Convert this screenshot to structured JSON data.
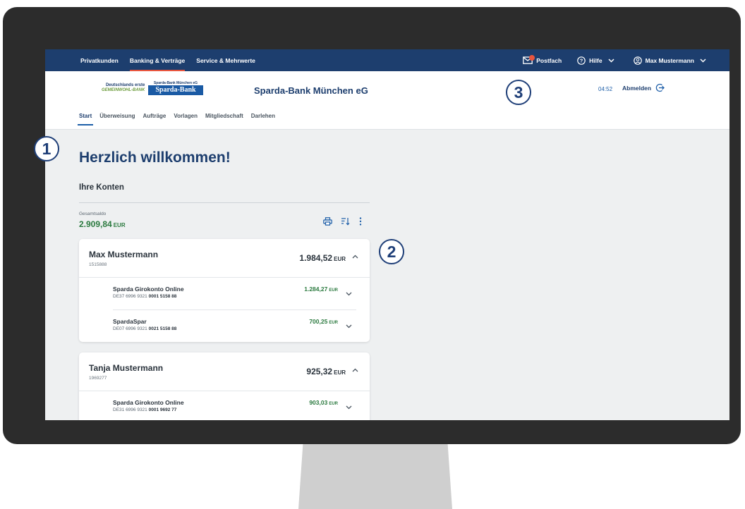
{
  "topnav": {
    "items": [
      {
        "label": "Privatkunden",
        "active": false
      },
      {
        "label": "Banking & Verträge",
        "active": true
      },
      {
        "label": "Service & Mehrwerte",
        "active": false
      }
    ],
    "postfach": "Postfach",
    "hilfe": "Hilfe",
    "user": "Max Mustermann"
  },
  "header": {
    "logo": {
      "tagline1": "Deutschlands erste",
      "tagline2": "GEMEINWOHL-BANK",
      "small": "Sparda-Bank München eG",
      "box": "Sparda-Bank"
    },
    "bank_name": "Sparda-Bank München eG",
    "timer": "04:52",
    "logout": "Abmelden",
    "tabs": [
      "Start",
      "Überweisung",
      "Aufträge",
      "Vorlagen",
      "Mitgliedschaft",
      "Darlehen"
    ]
  },
  "main": {
    "welcome": "Herzlich willkommen!",
    "konten_title": "Ihre Konten",
    "gesamtsaldo_label": "Gesamtsaldo",
    "gesamtsaldo_value": "2.909,84",
    "currency": "EUR",
    "cards": [
      {
        "owner": "Max Mustermann",
        "customer_no": "1515888",
        "total": "1.984,52",
        "accounts": [
          {
            "name": "Sparda Girokonto Online",
            "iban_prefix": "DE37 6996 9321",
            "iban_suffix": "0001 5158 88",
            "balance": "1.284,27"
          },
          {
            "name": "SpardaSpar",
            "iban_prefix": "DE07 6996 9321",
            "iban_suffix": "0021 5158 88",
            "balance": "700,25"
          }
        ]
      },
      {
        "owner": "Tanja Mustermann",
        "customer_no": "1969277",
        "total": "925,32",
        "accounts": [
          {
            "name": "Sparda Girokonto Online",
            "iban_prefix": "DE31 6996 9321",
            "iban_suffix": "0001 9692 77",
            "balance": "903,03"
          }
        ]
      }
    ]
  },
  "callouts": [
    "1",
    "2",
    "3"
  ],
  "colors": {
    "navy": "#1d3e6e",
    "accent": "#e8553e",
    "positive": "#2b7a3f",
    "link": "#1d5ea8"
  }
}
